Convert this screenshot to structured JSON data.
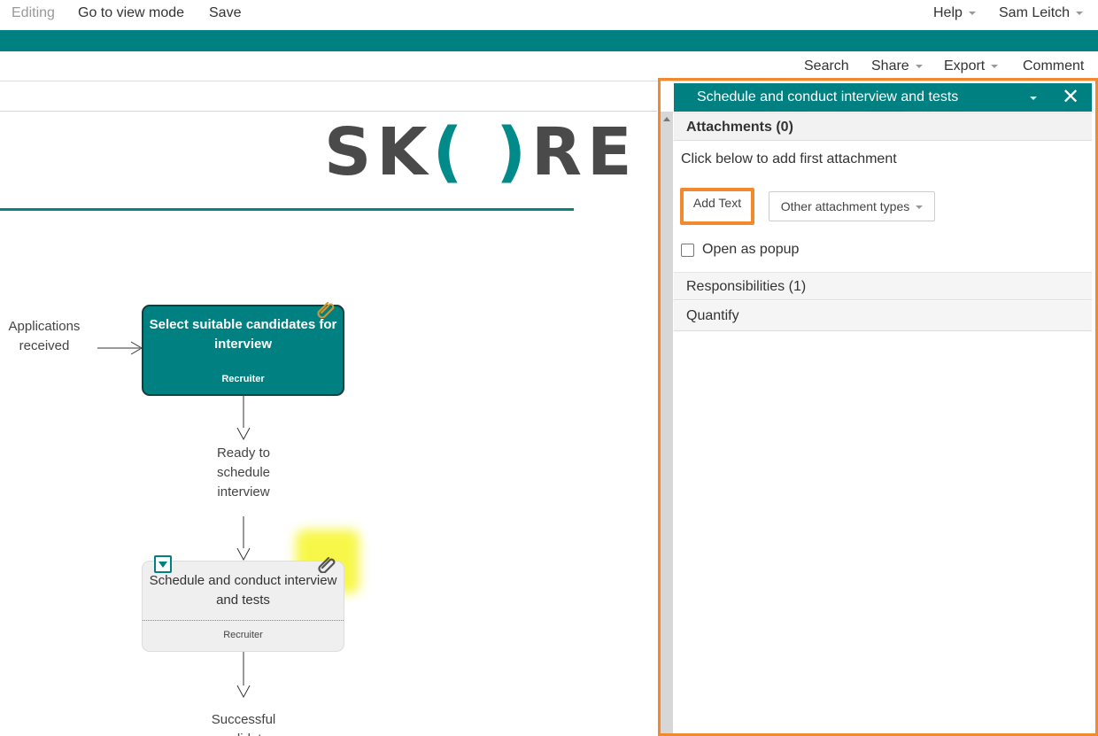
{
  "topbar": {
    "mode_label": "Editing",
    "view_mode": "Go to view mode",
    "save": "Save",
    "help": "Help",
    "user": "Sam Leitch"
  },
  "toolbar": {
    "search": "Search",
    "share": "Share",
    "export": "Export",
    "comment": "Comment"
  },
  "canvas": {
    "logo_left": "SK",
    "logo_mid": "( )",
    "logo_right": "RE",
    "input_label": "Applications received",
    "box1": {
      "title": "Select suitable candidates for interview",
      "role": "Recruiter"
    },
    "mid_label": "Ready to schedule interview",
    "box2": {
      "title": "Schedule and conduct interview and tests",
      "role": "Recruiter"
    },
    "bottom_label": "Successful candidates"
  },
  "panel": {
    "title": "Schedule and conduct interview and tests",
    "close": "✕",
    "attachments_header": "Attachments (0)",
    "hint": "Click below to add first attachment",
    "add_text": "Add Text",
    "other_types": "Other attachment types",
    "open_popup": "Open as popup",
    "responsibilities": "Responsibilities (1)",
    "quantify": "Quantify"
  },
  "colors": {
    "teal": "#008080",
    "highlight_orange": "#f08a2c",
    "clip_highlight": "#f6f62a"
  }
}
